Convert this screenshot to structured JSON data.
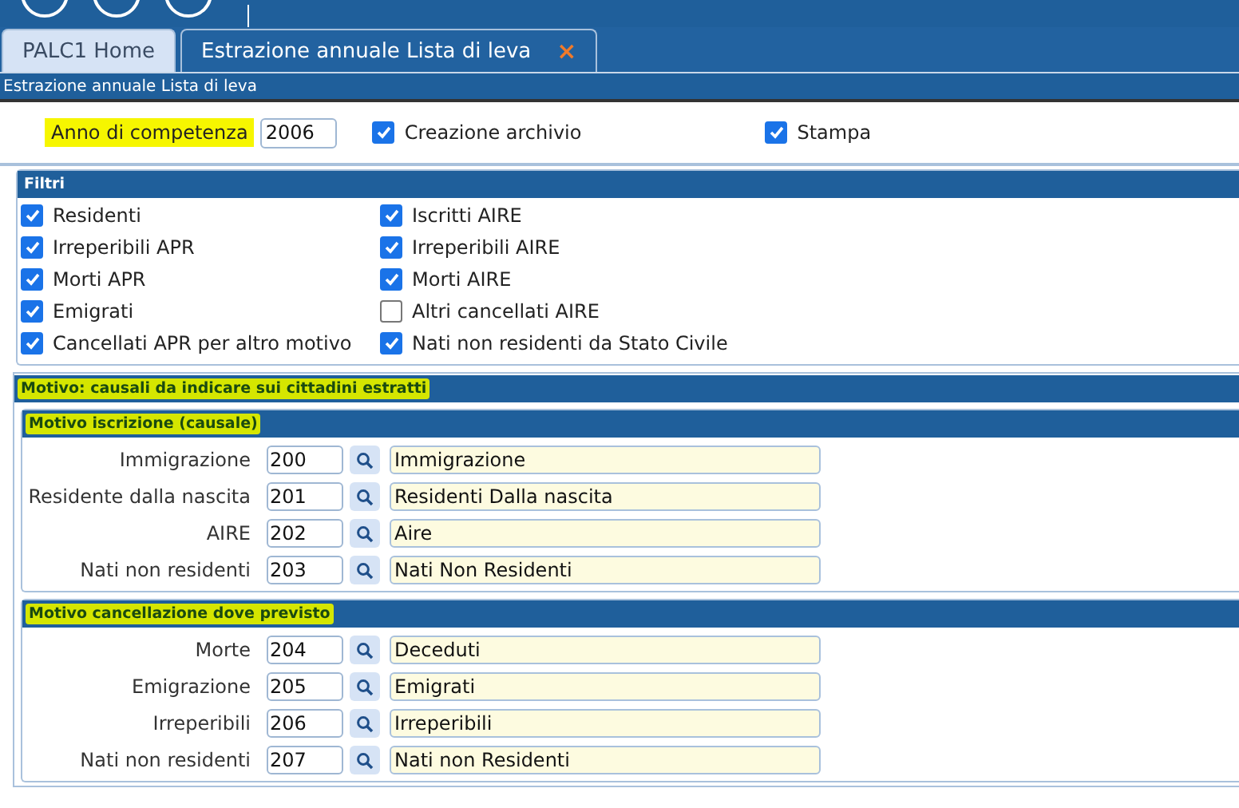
{
  "tabs": [
    {
      "label": "PALC1 Home",
      "selected": false
    },
    {
      "label": "Estrazione annuale Lista di leva",
      "selected": true,
      "close": "×"
    }
  ],
  "subtitle": "Estrazione annuale Lista di leva",
  "top_row": {
    "year_label": "Anno di competenza",
    "year_label_highlighted": true,
    "year_value": "2006",
    "checks": [
      {
        "label": "Creazione archivio",
        "checked": true
      },
      {
        "label": "Stampa",
        "checked": true
      }
    ]
  },
  "filters": {
    "title": "Filtri",
    "items": [
      {
        "label": "Residenti",
        "checked": true
      },
      {
        "label": "Iscritti AIRE",
        "checked": true
      },
      {
        "label": "Irreperibili APR",
        "checked": true
      },
      {
        "label": "Irreperibili AIRE",
        "checked": true
      },
      {
        "label": "Morti APR",
        "checked": true
      },
      {
        "label": "Morti AIRE",
        "checked": true
      },
      {
        "label": "Emigrati",
        "checked": true
      },
      {
        "label": "Altri cancellati AIRE",
        "checked": false
      },
      {
        "label": "Cancellati APR per altro motivo",
        "checked": true
      },
      {
        "label": "Nati non residenti da Stato Civile",
        "checked": true
      }
    ]
  },
  "motivo": {
    "title": "Motivo: causali da indicare sui cittadini estratti",
    "highlighted": true,
    "groups": [
      {
        "title": "Motivo iscrizione (causale)",
        "highlighted": true,
        "rows": [
          {
            "label": "Immigrazione",
            "code": "200",
            "description": "Immigrazione"
          },
          {
            "label": "Residente dalla nascita",
            "code": "201",
            "description": "Residenti Dalla nascita"
          },
          {
            "label": "AIRE",
            "code": "202",
            "description": "Aire"
          },
          {
            "label": "Nati non residenti",
            "code": "203",
            "description": "Nati Non Residenti"
          }
        ]
      },
      {
        "title": "Motivo cancellazione dove previsto",
        "highlighted": true,
        "rows": [
          {
            "label": "Morte",
            "code": "204",
            "description": "Deceduti"
          },
          {
            "label": "Emigrazione",
            "code": "205",
            "description": "Emigrati"
          },
          {
            "label": "Irreperibili",
            "code": "206",
            "description": "Irreperibili"
          },
          {
            "label": "Nati non residenti",
            "code": "207",
            "description": "Nati non Residenti"
          }
        ]
      }
    ]
  }
}
